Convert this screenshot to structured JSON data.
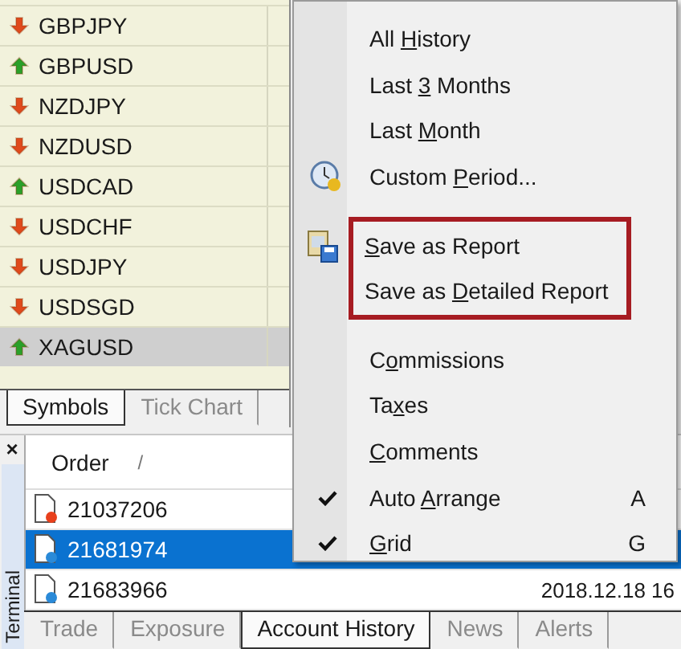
{
  "symbols": [
    {
      "name": "GBPJPY",
      "kind": "down",
      "selected": false
    },
    {
      "name": "GBPUSD",
      "kind": "up",
      "selected": false
    },
    {
      "name": "NZDJPY",
      "kind": "down",
      "selected": false
    },
    {
      "name": "NZDUSD",
      "kind": "down",
      "selected": false
    },
    {
      "name": "USDCAD",
      "kind": "up",
      "selected": false
    },
    {
      "name": "USDCHF",
      "kind": "down",
      "selected": false
    },
    {
      "name": "USDJPY",
      "kind": "down",
      "selected": false
    },
    {
      "name": "USDSGD",
      "kind": "down",
      "selected": false
    },
    {
      "name": "XAGUSD",
      "kind": "up",
      "selected": true
    }
  ],
  "symbol_tabs": [
    {
      "label": "Symbols",
      "selected": true
    },
    {
      "label": "Tick Chart",
      "selected": false
    }
  ],
  "terminal": {
    "title": "Terminal",
    "close": "×",
    "columns": [
      {
        "label": "Order",
        "sort": "/"
      }
    ],
    "rows": [
      {
        "order": "21037206",
        "color": "#e8401c",
        "selected": false
      },
      {
        "order": "21681974",
        "color": "#2a8ad8",
        "selected": true
      },
      {
        "order": "21683966",
        "color": "#2a8ad8",
        "selected": false,
        "time": "2018.12.18 16"
      }
    ],
    "tabs": [
      {
        "label": "Trade",
        "selected": false
      },
      {
        "label": "Exposure",
        "selected": false
      },
      {
        "label": "Account History",
        "selected": true
      },
      {
        "label": "News",
        "selected": false
      },
      {
        "label": "Alerts",
        "selected": false
      }
    ]
  },
  "context_menu": {
    "groups": [
      {
        "highlighted": false,
        "items": [
          {
            "pre": "All ",
            "key": "H",
            "post": "istory",
            "checked": false
          },
          {
            "pre": "Last ",
            "key": "3",
            "post": " Months",
            "checked": false
          },
          {
            "pre": "Last ",
            "key": "M",
            "post": "onth",
            "checked": false
          },
          {
            "pre": "Custom ",
            "key": "P",
            "post": "eriod...",
            "checked": false
          }
        ]
      },
      {
        "highlighted": true,
        "items": [
          {
            "key": "S",
            "post": "ave as Report",
            "checked": false
          },
          {
            "pre": "Save as ",
            "key": "D",
            "post": "etailed Report",
            "checked": false
          }
        ]
      },
      {
        "highlighted": false,
        "items": [
          {
            "pre": "C",
            "key": "o",
            "post": "mmissions",
            "checked": false
          },
          {
            "pre": "Ta",
            "key": "x",
            "post": "es",
            "checked": false
          },
          {
            "key": "C",
            "post": "omments",
            "checked": false
          },
          {
            "pre": "Auto ",
            "key": "A",
            "post": "rrange",
            "checked": true,
            "shortcut": "A"
          },
          {
            "key": "G",
            "post": "rid",
            "checked": true,
            "shortcut": "G"
          }
        ]
      }
    ]
  }
}
